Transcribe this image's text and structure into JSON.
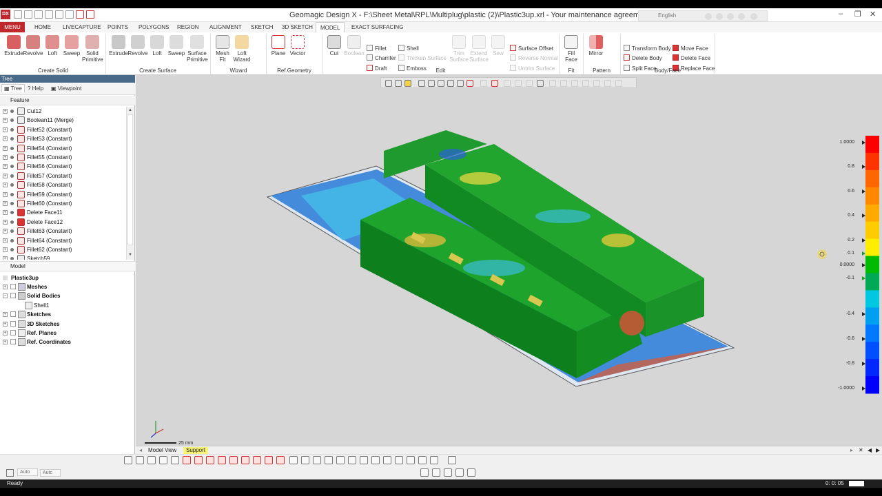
{
  "window": {
    "title": "Geomagic Design X - F:\\Sheet Metal\\RPL\\Multiplug\\plastic (2)\\Plastic3up.xrl - Your maintenance agreement has expired.",
    "logo": "DX",
    "language": "English"
  },
  "menu": {
    "menu_label": "MENU",
    "tabs": [
      "HOME",
      "LIVECAPTURE",
      "POINTS",
      "POLYGONS",
      "REGION",
      "ALIGNMENT",
      "SKETCH",
      "3D SKETCH",
      "MODEL",
      "EXACT SURFACING"
    ],
    "active_tab": "MODEL"
  },
  "ribbon": {
    "create_solid": {
      "label": "Create Solid",
      "buttons": [
        "Extrude",
        "Revolve",
        "Loft",
        "Sweep",
        "Solid Primitive"
      ]
    },
    "create_surface": {
      "label": "Create Surface",
      "buttons": [
        "Extrude",
        "Revolve",
        "Loft",
        "Sweep",
        "Surface Primitive"
      ]
    },
    "wizard": {
      "label": "Wizard",
      "buttons": [
        "Mesh Fit",
        "Loft Wizard"
      ]
    },
    "ref_geometry": {
      "label": "Ref.Geometry",
      "buttons": [
        "Plane",
        "Vector"
      ]
    },
    "edit": {
      "label": "Edit",
      "buttons": [
        "Cut",
        "Boolean"
      ],
      "small_col1": [
        "Fillet",
        "Chamfer",
        "Draft"
      ],
      "small_col2": [
        "Shell",
        "Thicken Surface",
        "Emboss"
      ],
      "disabled_buttons": [
        "Trim Surface",
        "Extend Surface",
        "Sew"
      ],
      "small_col3": [
        "Surface Offset",
        "Reverse Normal",
        "Untrim Surface"
      ]
    },
    "fit": {
      "label": "Fit",
      "button": "Fill Face"
    },
    "pattern": {
      "label": "Pattern",
      "button": "Mirror"
    },
    "body_face": {
      "label": "Body/Face",
      "col1": [
        "Transform Body",
        "Delete Body",
        "Split Face"
      ],
      "col2": [
        "Move Face",
        "Delete Face",
        "Replace Face"
      ]
    }
  },
  "left_panel": {
    "header": "Tree",
    "tabs": [
      "Tree",
      "Help",
      "Viewpoint"
    ],
    "feature_header": "Feature",
    "features": [
      {
        "name": "Cut12",
        "type": "gray"
      },
      {
        "name": "Boolean11 (Merge)",
        "type": "gray"
      },
      {
        "name": "Fillet52 (Constant)",
        "type": "fillet"
      },
      {
        "name": "Fillet53 (Constant)",
        "type": "fillet"
      },
      {
        "name": "Fillet54 (Constant)",
        "type": "fillet"
      },
      {
        "name": "Fillet55 (Constant)",
        "type": "fillet"
      },
      {
        "name": "Fillet56 (Constant)",
        "type": "fillet"
      },
      {
        "name": "Fillet57 (Constant)",
        "type": "fillet"
      },
      {
        "name": "Fillet58 (Constant)",
        "type": "fillet"
      },
      {
        "name": "Fillet59 (Constant)",
        "type": "fillet"
      },
      {
        "name": "Fillet60 (Constant)",
        "type": "fillet"
      },
      {
        "name": "Delete Face11",
        "type": "delete"
      },
      {
        "name": "Delete Face12",
        "type": "delete"
      },
      {
        "name": "Fillet63 (Constant)",
        "type": "fillet"
      },
      {
        "name": "Fillet64 (Constant)",
        "type": "fillet"
      },
      {
        "name": "Fillet62 (Constant)",
        "type": "fillet"
      },
      {
        "name": "Sketch59",
        "type": "gray"
      }
    ],
    "model_header": "Model",
    "model_root": "Plastic3up",
    "model_items": [
      {
        "name": "Meshes",
        "indent": 0
      },
      {
        "name": "Solid Bodies",
        "indent": 0
      },
      {
        "name": "Shell1",
        "indent": 1
      },
      {
        "name": "Sketches",
        "indent": 0
      },
      {
        "name": "3D Sketches",
        "indent": 0
      },
      {
        "name": "Ref. Planes",
        "indent": 0
      },
      {
        "name": "Ref. Coordinates",
        "indent": 0
      }
    ]
  },
  "viewport": {
    "scale_label": "25 mm",
    "colormap_labels": [
      "1.0000",
      "0.8",
      "0.6",
      "0.4",
      "0.2",
      "0.1",
      "0.0000",
      "-0.1",
      "-0.4",
      "-0.6",
      "-0.8",
      "-1.0000"
    ],
    "colormap_colors": [
      "#ff0000",
      "#ff3300",
      "#ff6600",
      "#ff8800",
      "#ffaa00",
      "#ffcc00",
      "#ffee00",
      "#00bb00",
      "#00aa55",
      "#00c8e0",
      "#00a0f0",
      "#0078ff",
      "#0050ff",
      "#0028ff",
      "#0000ff"
    ]
  },
  "view_tabs": [
    "Model View",
    "Support"
  ],
  "bottom": {
    "input1": "Auto",
    "input2": "Autc"
  },
  "status": {
    "left": "Ready",
    "right": "0: 0: 05"
  }
}
